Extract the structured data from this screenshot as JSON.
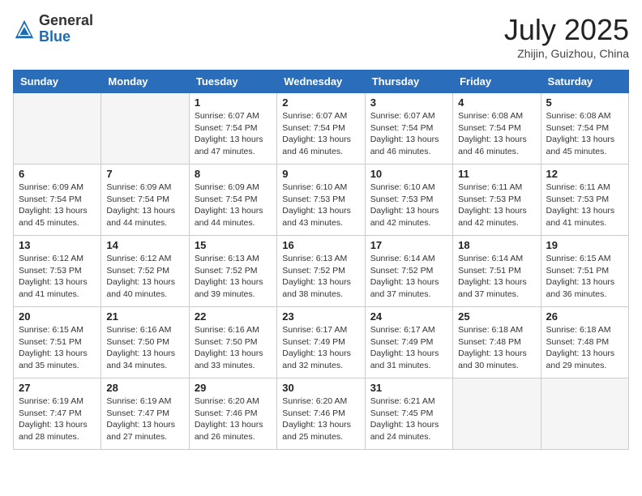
{
  "header": {
    "logo_line1": "General",
    "logo_line2": "Blue",
    "month_title": "July 2025",
    "location": "Zhijin, Guizhou, China"
  },
  "weekdays": [
    "Sunday",
    "Monday",
    "Tuesday",
    "Wednesday",
    "Thursday",
    "Friday",
    "Saturday"
  ],
  "weeks": [
    [
      {
        "day": "",
        "info": ""
      },
      {
        "day": "",
        "info": ""
      },
      {
        "day": "1",
        "info": "Sunrise: 6:07 AM\nSunset: 7:54 PM\nDaylight: 13 hours and 47 minutes."
      },
      {
        "day": "2",
        "info": "Sunrise: 6:07 AM\nSunset: 7:54 PM\nDaylight: 13 hours and 46 minutes."
      },
      {
        "day": "3",
        "info": "Sunrise: 6:07 AM\nSunset: 7:54 PM\nDaylight: 13 hours and 46 minutes."
      },
      {
        "day": "4",
        "info": "Sunrise: 6:08 AM\nSunset: 7:54 PM\nDaylight: 13 hours and 46 minutes."
      },
      {
        "day": "5",
        "info": "Sunrise: 6:08 AM\nSunset: 7:54 PM\nDaylight: 13 hours and 45 minutes."
      }
    ],
    [
      {
        "day": "6",
        "info": "Sunrise: 6:09 AM\nSunset: 7:54 PM\nDaylight: 13 hours and 45 minutes."
      },
      {
        "day": "7",
        "info": "Sunrise: 6:09 AM\nSunset: 7:54 PM\nDaylight: 13 hours and 44 minutes."
      },
      {
        "day": "8",
        "info": "Sunrise: 6:09 AM\nSunset: 7:54 PM\nDaylight: 13 hours and 44 minutes."
      },
      {
        "day": "9",
        "info": "Sunrise: 6:10 AM\nSunset: 7:53 PM\nDaylight: 13 hours and 43 minutes."
      },
      {
        "day": "10",
        "info": "Sunrise: 6:10 AM\nSunset: 7:53 PM\nDaylight: 13 hours and 42 minutes."
      },
      {
        "day": "11",
        "info": "Sunrise: 6:11 AM\nSunset: 7:53 PM\nDaylight: 13 hours and 42 minutes."
      },
      {
        "day": "12",
        "info": "Sunrise: 6:11 AM\nSunset: 7:53 PM\nDaylight: 13 hours and 41 minutes."
      }
    ],
    [
      {
        "day": "13",
        "info": "Sunrise: 6:12 AM\nSunset: 7:53 PM\nDaylight: 13 hours and 41 minutes."
      },
      {
        "day": "14",
        "info": "Sunrise: 6:12 AM\nSunset: 7:52 PM\nDaylight: 13 hours and 40 minutes."
      },
      {
        "day": "15",
        "info": "Sunrise: 6:13 AM\nSunset: 7:52 PM\nDaylight: 13 hours and 39 minutes."
      },
      {
        "day": "16",
        "info": "Sunrise: 6:13 AM\nSunset: 7:52 PM\nDaylight: 13 hours and 38 minutes."
      },
      {
        "day": "17",
        "info": "Sunrise: 6:14 AM\nSunset: 7:52 PM\nDaylight: 13 hours and 37 minutes."
      },
      {
        "day": "18",
        "info": "Sunrise: 6:14 AM\nSunset: 7:51 PM\nDaylight: 13 hours and 37 minutes."
      },
      {
        "day": "19",
        "info": "Sunrise: 6:15 AM\nSunset: 7:51 PM\nDaylight: 13 hours and 36 minutes."
      }
    ],
    [
      {
        "day": "20",
        "info": "Sunrise: 6:15 AM\nSunset: 7:51 PM\nDaylight: 13 hours and 35 minutes."
      },
      {
        "day": "21",
        "info": "Sunrise: 6:16 AM\nSunset: 7:50 PM\nDaylight: 13 hours and 34 minutes."
      },
      {
        "day": "22",
        "info": "Sunrise: 6:16 AM\nSunset: 7:50 PM\nDaylight: 13 hours and 33 minutes."
      },
      {
        "day": "23",
        "info": "Sunrise: 6:17 AM\nSunset: 7:49 PM\nDaylight: 13 hours and 32 minutes."
      },
      {
        "day": "24",
        "info": "Sunrise: 6:17 AM\nSunset: 7:49 PM\nDaylight: 13 hours and 31 minutes."
      },
      {
        "day": "25",
        "info": "Sunrise: 6:18 AM\nSunset: 7:48 PM\nDaylight: 13 hours and 30 minutes."
      },
      {
        "day": "26",
        "info": "Sunrise: 6:18 AM\nSunset: 7:48 PM\nDaylight: 13 hours and 29 minutes."
      }
    ],
    [
      {
        "day": "27",
        "info": "Sunrise: 6:19 AM\nSunset: 7:47 PM\nDaylight: 13 hours and 28 minutes."
      },
      {
        "day": "28",
        "info": "Sunrise: 6:19 AM\nSunset: 7:47 PM\nDaylight: 13 hours and 27 minutes."
      },
      {
        "day": "29",
        "info": "Sunrise: 6:20 AM\nSunset: 7:46 PM\nDaylight: 13 hours and 26 minutes."
      },
      {
        "day": "30",
        "info": "Sunrise: 6:20 AM\nSunset: 7:46 PM\nDaylight: 13 hours and 25 minutes."
      },
      {
        "day": "31",
        "info": "Sunrise: 6:21 AM\nSunset: 7:45 PM\nDaylight: 13 hours and 24 minutes."
      },
      {
        "day": "",
        "info": ""
      },
      {
        "day": "",
        "info": ""
      }
    ]
  ]
}
